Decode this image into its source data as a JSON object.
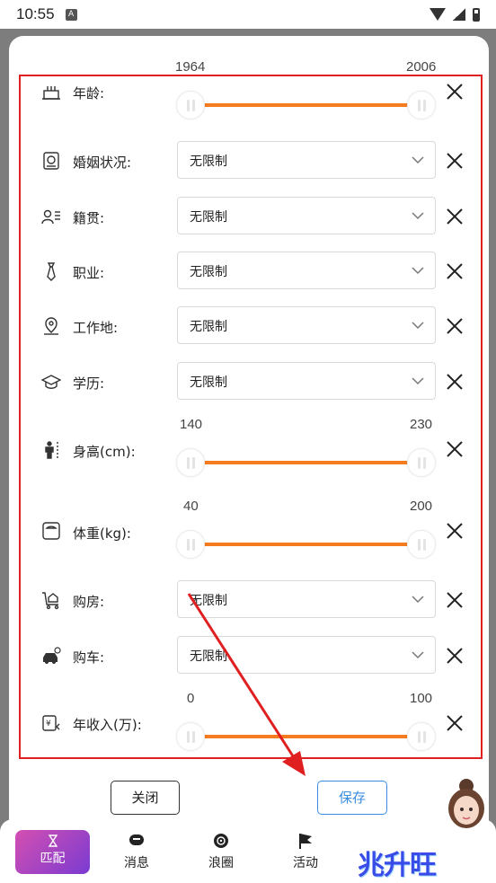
{
  "status_bar": {
    "time": "10:55",
    "notification_glyph": "A"
  },
  "filters": {
    "age": {
      "label": "年龄:",
      "min": "1964",
      "max": "2006"
    },
    "marriage": {
      "label": "婚姻状况:",
      "value": "无限制"
    },
    "hometown": {
      "label": "籍贯:",
      "value": "无限制"
    },
    "occupation": {
      "label": "职业:",
      "value": "无限制"
    },
    "workplace": {
      "label": "工作地:",
      "value": "无限制"
    },
    "education": {
      "label": "学历:",
      "value": "无限制"
    },
    "height": {
      "label": "身高(cm):",
      "min": "140",
      "max": "230"
    },
    "weight": {
      "label": "体重(kg):",
      "min": "40",
      "max": "200"
    },
    "house": {
      "label": "购房:",
      "value": "无限制"
    },
    "car": {
      "label": "购车:",
      "value": "无限制"
    },
    "income": {
      "label": "年收入(万):",
      "min": "0",
      "max": "100"
    }
  },
  "buttons": {
    "close": "关闭",
    "save": "保存"
  },
  "tabbar": {
    "match": "匹配",
    "messages": "消息",
    "moments": "浪圈",
    "activity": "活动"
  },
  "watermark": "兆升旺",
  "colors": {
    "accent_orange": "#f47b20",
    "annotation_red": "#e02020",
    "save_blue": "#3b8de0",
    "tab_active_start": "#d44fb1",
    "tab_active_end": "#7a3bd1"
  },
  "icons": [
    "cake-icon",
    "marriage-certificate-icon",
    "hometown-id-icon",
    "tie-icon",
    "location-pin-icon",
    "graduation-cap-icon",
    "height-person-icon",
    "scale-icon",
    "house-cart-icon",
    "car-icon",
    "yuan-income-icon",
    "close-icon",
    "chevron-down-icon",
    "hourglass-icon",
    "chat-bubble-icon",
    "vinyl-icon",
    "flag-icon"
  ]
}
